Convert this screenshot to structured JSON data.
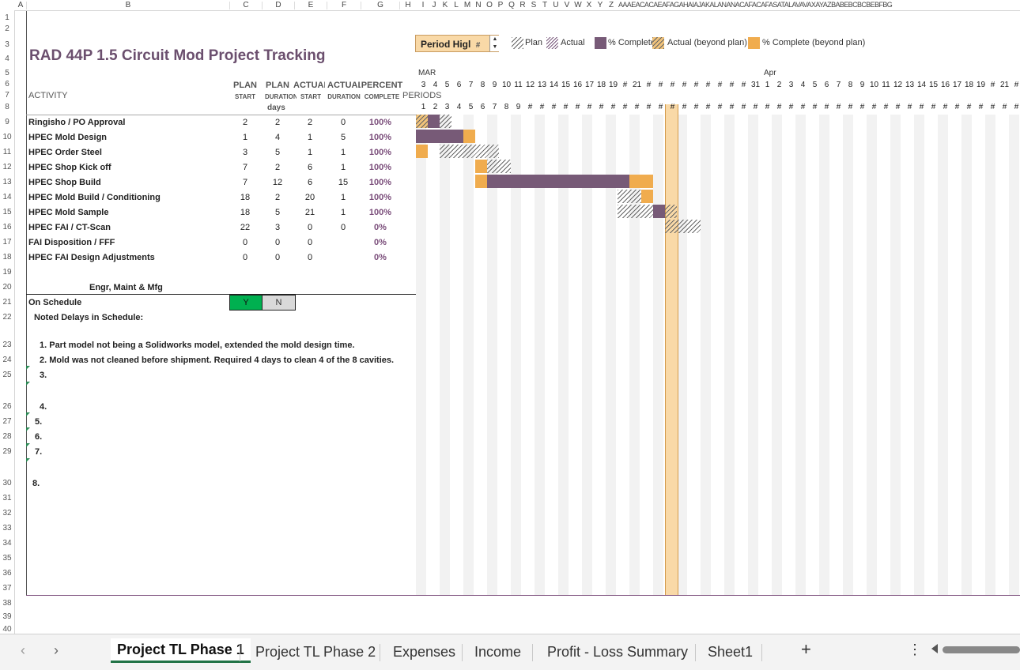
{
  "column_headers": [
    "A",
    "B",
    "C",
    "D",
    "E",
    "F",
    "G",
    "H",
    "I",
    "J",
    "K",
    "L",
    "M",
    "N",
    "O",
    "P",
    "Q",
    "R",
    "S",
    "T",
    "U",
    "V",
    "W",
    "X",
    "Y",
    "Z",
    "AAAEACACAEAFAGAHAIAJAKALANANACAFACAFASATALAVAVAXAYAZBABEBCBCBEBFBG"
  ],
  "row_headers": [
    "1",
    "2",
    "3",
    "4",
    "5",
    "6",
    "7",
    "8",
    "9",
    "10",
    "11",
    "12",
    "13",
    "14",
    "15",
    "16",
    "17",
    "18",
    "19",
    "20",
    "21",
    "22",
    "23",
    "24",
    "25",
    "26",
    "27",
    "28",
    "29",
    "30",
    "31",
    "32",
    "33",
    "34",
    "35",
    "36",
    "37",
    "38",
    "39",
    "40"
  ],
  "title": "RAD 44P 1.5 Circuit Mod Project Tracking",
  "period_highlight": {
    "label": "Period Higl",
    "value": "#"
  },
  "legend": {
    "plan": "Plan",
    "actual": "Actual",
    "complete": "% Complete",
    "actual_beyond": "Actual (beyond plan)",
    "complete_beyond": "% Complete (beyond plan)"
  },
  "headers": {
    "activity": "ACTIVITY",
    "plan_start_top": "PLAN",
    "plan_start_sub": "START",
    "plan_dur_top": "PLAN",
    "plan_dur_sub": "DURATION",
    "actual_start_top": "ACTUAL",
    "actual_start_sub": "START",
    "actual_dur_top": "ACTUAL",
    "actual_dur_sub": "DURATION",
    "percent_top": "PERCENT",
    "percent_sub": "COMPLETE",
    "periods": "PERIODS",
    "days": "days"
  },
  "months": {
    "mar": "MAR",
    "apr": "Apr"
  },
  "date_ticks": [
    "3",
    "4",
    "5",
    "6",
    "7",
    "8",
    "9",
    "10",
    "11",
    "12",
    "13",
    "14",
    "15",
    "16",
    "17",
    "18",
    "19",
    "#",
    "21",
    "#",
    "#",
    "#",
    "#",
    "#",
    "#",
    "#",
    "#",
    "#",
    "31",
    "1",
    "2",
    "3",
    "4",
    "5",
    "6",
    "7",
    "8",
    "9",
    "10",
    "11",
    "12",
    "13",
    "14",
    "15",
    "16",
    "17",
    "18",
    "19",
    "#",
    "21",
    "#"
  ],
  "period_ticks": [
    "1",
    "2",
    "3",
    "4",
    "5",
    "6",
    "7",
    "8",
    "9",
    "#",
    "#",
    "#",
    "#",
    "#",
    "#",
    "#",
    "#",
    "#",
    "#",
    "#",
    "#",
    "#",
    "#",
    "#",
    "#",
    "#",
    "#",
    "#",
    "#",
    "#",
    "#",
    "#",
    "#",
    "#",
    "#",
    "#",
    "#",
    "#",
    "#",
    "#",
    "#",
    "#",
    "#",
    "#",
    "#",
    "#",
    "#",
    "#",
    "#",
    "#",
    "#"
  ],
  "activities": [
    {
      "name": "Ringisho / PO Approval",
      "plan_start": "2",
      "plan_dur": "2",
      "actual_start": "2",
      "actual_dur": "0",
      "pct": "100%"
    },
    {
      "name": "HPEC Mold Design",
      "plan_start": "1",
      "plan_dur": "4",
      "actual_start": "1",
      "actual_dur": "5",
      "pct": "100%"
    },
    {
      "name": "HPEC Order Steel",
      "plan_start": "3",
      "plan_dur": "5",
      "actual_start": "1",
      "actual_dur": "1",
      "pct": "100%"
    },
    {
      "name": "HPEC Shop Kick off",
      "plan_start": "7",
      "plan_dur": "2",
      "actual_start": "6",
      "actual_dur": "1",
      "pct": "100%"
    },
    {
      "name": "HPEC Shop Build",
      "plan_start": "7",
      "plan_dur": "12",
      "actual_start": "6",
      "actual_dur": "15",
      "pct": "100%"
    },
    {
      "name": "HPEC Mold Build / Conditioning",
      "plan_start": "18",
      "plan_dur": "2",
      "actual_start": "20",
      "actual_dur": "1",
      "pct": "100%"
    },
    {
      "name": "HPEC Mold Sample",
      "plan_start": "18",
      "plan_dur": "5",
      "actual_start": "21",
      "actual_dur": "1",
      "pct": "100%"
    },
    {
      "name": "HPEC FAI / CT-Scan",
      "plan_start": "22",
      "plan_dur": "3",
      "actual_start": "0",
      "actual_dur": "0",
      "pct": "0%"
    },
    {
      "name": "FAI Disposition / FFF",
      "plan_start": "0",
      "plan_dur": "0",
      "actual_start": "0",
      "actual_dur": "",
      "pct": "0%"
    },
    {
      "name": "HPEC FAI Design Adjustments",
      "plan_start": "0",
      "plan_dur": "0",
      "actual_start": "0",
      "actual_dur": "",
      "pct": "0%"
    }
  ],
  "section": {
    "engr": "Engr, Maint & Mfg",
    "on_schedule": "On Schedule",
    "yes": "Y",
    "no": "N",
    "delays": "Noted Delays in Schedule:"
  },
  "delays": [
    "1. Part model not being a Solidworks model, extended the mold design time.",
    "2. Mold was not cleaned before shipment. Required 4 days to clean 4 of the 8 cavities.",
    "3.",
    "4.",
    "5.",
    "6.",
    "7.",
    "8."
  ],
  "tabs": [
    "Project TL Phase 1",
    "Project TL Phase 2",
    "Expenses",
    "Income",
    "Profit - Loss Summary",
    "Sheet1"
  ],
  "add_sheet": "+",
  "more": "⋮",
  "colors": {
    "purple": "#775a77",
    "orange": "#f0ac4e",
    "title": "#6b4f6e",
    "green": "#00b050",
    "highlight": "#f9d9a7"
  }
}
